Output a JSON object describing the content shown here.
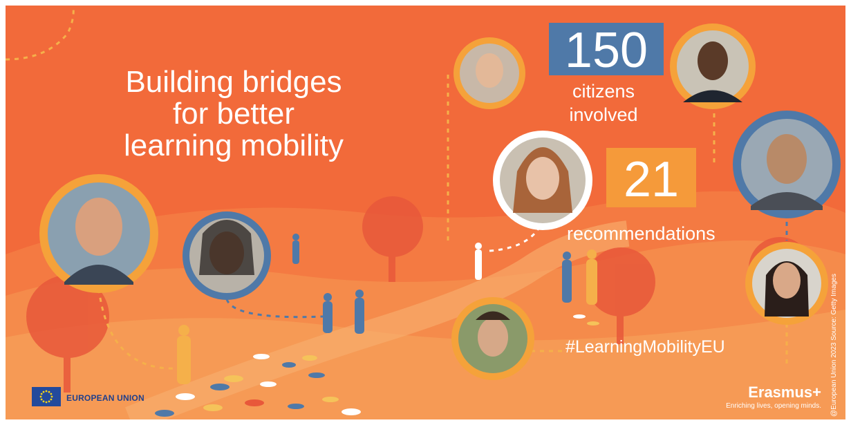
{
  "headline": [
    "Building bridges",
    "for better",
    "learning mobility"
  ],
  "stats": [
    {
      "number": "150",
      "label": [
        "citizens",
        "involved"
      ]
    },
    {
      "number": "21",
      "label": [
        "recommendations"
      ]
    }
  ],
  "hashtag": "#LearningMobilityEU",
  "footer": {
    "eu_label": "EUROPEAN UNION",
    "program_name": "Erasmus+",
    "tagline": "Enriching lives, opening minds."
  },
  "credit": "@European Union 2023 Source: Getty Images",
  "colors": {
    "background": "#f26a3a",
    "stat_blue": "#4f79a8",
    "stat_orange": "#f59a3a",
    "ring_orange": "#f5a23a",
    "ring_blue": "#4f79a8",
    "ring_white": "#ffffff"
  }
}
